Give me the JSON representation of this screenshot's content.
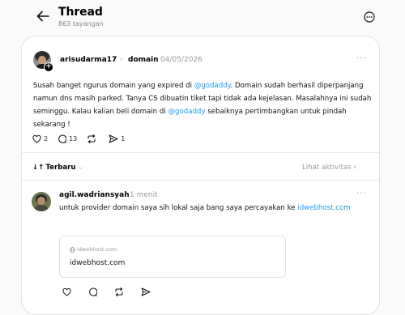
{
  "header": {
    "title": "Thread",
    "subtitle": "863 tayangan"
  },
  "post": {
    "username": "arisudarma17",
    "separator": "›",
    "topic": "domain",
    "date": "04/05/2026",
    "text": {
      "part1": "Susah banget ngurus domain yang expired di ",
      "mention1": "@godaddy",
      "part2": ". Domain sudah berhasil diperpanjang namun dns masih parked. Tanya CS dibuatin tiket tapi tidak ada kejelasan. Masalahnya ini sudah seminggu. Kalau kalian beli domain di ",
      "mention2": "@godaddy",
      "part3": " sebaiknya pertimbangkan untuk pindah sekarang !"
    },
    "likes": "2",
    "replies": "13",
    "shares": "1"
  },
  "sort": {
    "label": "Terbaru",
    "activity": "Lihat aktivitas"
  },
  "reply": {
    "username": "agil.wadriansyah",
    "time": "1 menit",
    "text": "untuk provider domain saya sih lokal saja bang saya percayakan ke ",
    "link": "idwebhost.com",
    "preview": {
      "domain": "idwebhost.com",
      "title": "idwebhost.com"
    }
  },
  "icons": {
    "back": "arrow-left-icon",
    "more": "more-circle-icon",
    "like": "heart-icon",
    "comment": "comment-icon",
    "repost": "repost-icon",
    "share": "share-icon",
    "globe": "globe-icon"
  },
  "colors": {
    "mention": "#1d9bf0",
    "muted": "#999999",
    "background": "#fafafa"
  }
}
